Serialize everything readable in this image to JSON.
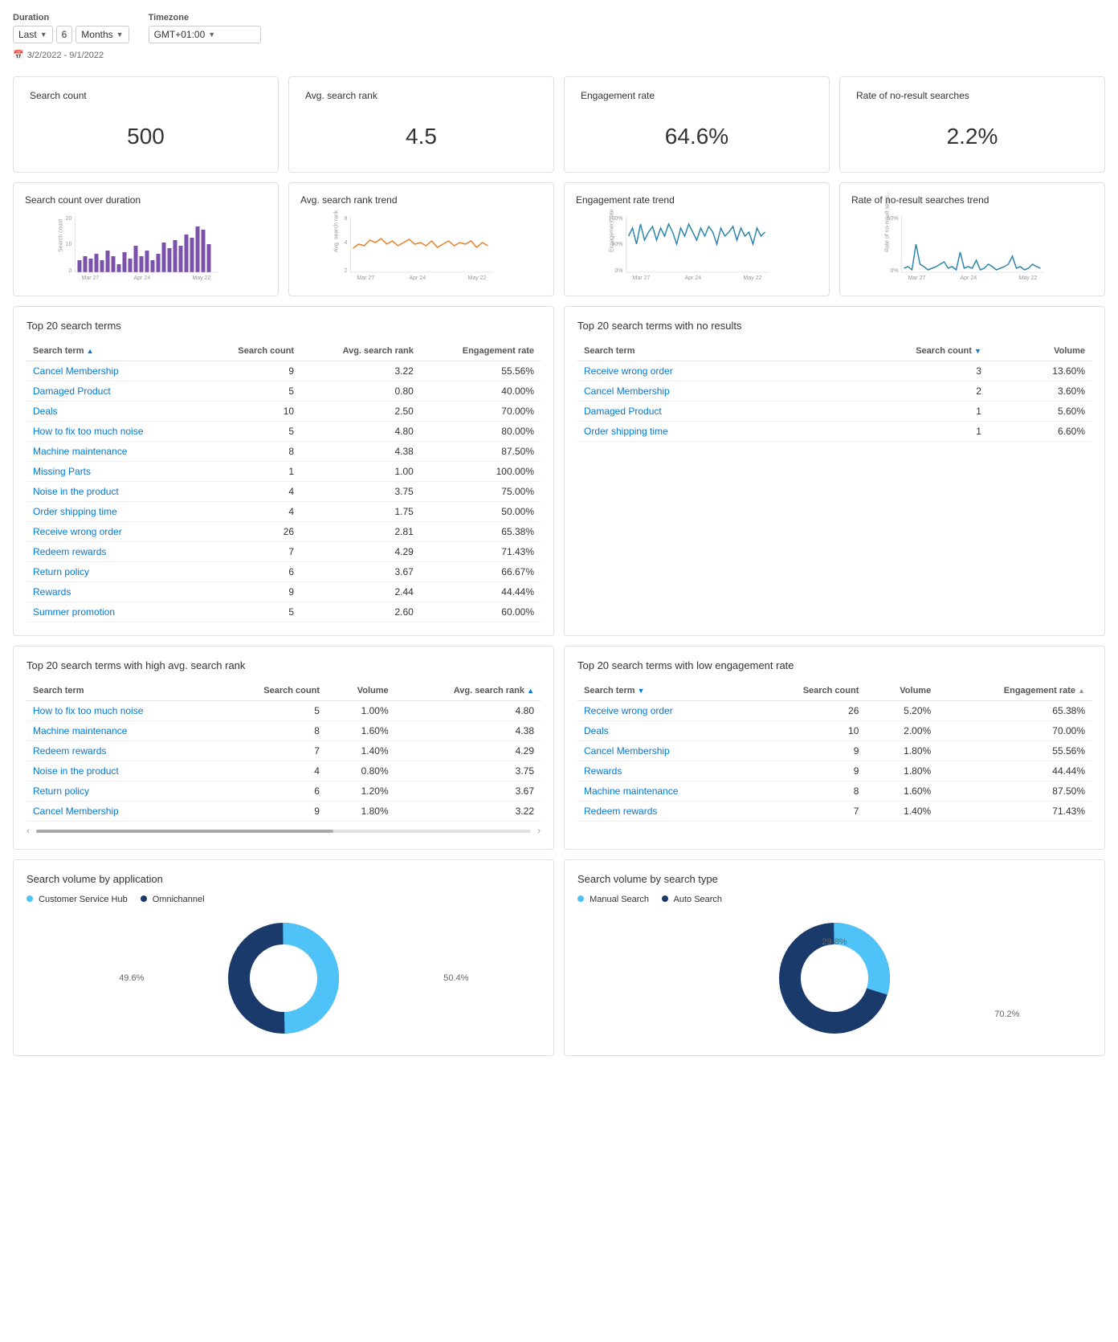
{
  "header": {
    "duration_label": "Duration",
    "timezone_label": "Timezone",
    "duration_prefix": "Last",
    "duration_value": "6",
    "duration_unit": "Months",
    "timezone_value": "GMT+01:00",
    "date_range": "3/2/2022 - 9/1/2022"
  },
  "stats": [
    {
      "title": "Search count",
      "value": "500"
    },
    {
      "title": "Avg. search rank",
      "value": "4.5"
    },
    {
      "title": "Engagement rate",
      "value": "64.6%"
    },
    {
      "title": "Rate of no-result searches",
      "value": "2.2%"
    }
  ],
  "chart_cards": [
    {
      "title": "Search count over duration",
      "type": "bar",
      "color": "#7B52AB",
      "ymax": 20,
      "ylabel": "Search count",
      "labels": [
        "Mar 27",
        "Apr 24",
        "May 22"
      ]
    },
    {
      "title": "Avg. search rank trend",
      "type": "line",
      "color": "#E8822B",
      "ymax": 8,
      "ylabel": "Avg. search rank",
      "labels": [
        "Mar 27",
        "Apr 24",
        "May 22"
      ]
    },
    {
      "title": "Engagement rate trend",
      "type": "line",
      "color": "#2E86AB",
      "ymax": 100,
      "ylabel": "Engagement rate",
      "labels": [
        "Mar 27",
        "Apr 24",
        "May 22"
      ]
    },
    {
      "title": "Rate of no-result searches trend",
      "type": "line",
      "color": "#2E86AB",
      "ymax": 50,
      "ylabel": "Rate of no-result searc...",
      "labels": [
        "Mar 27",
        "Apr 24",
        "May 22"
      ]
    }
  ],
  "top20_table": {
    "title": "Top 20 search terms",
    "columns": [
      "Search term",
      "Search count",
      "Avg. search rank",
      "Engagement rate"
    ],
    "rows": [
      [
        "Cancel Membership",
        "9",
        "3.22",
        "55.56%"
      ],
      [
        "Damaged Product",
        "5",
        "0.80",
        "40.00%"
      ],
      [
        "Deals",
        "10",
        "2.50",
        "70.00%"
      ],
      [
        "How to fix too much noise",
        "5",
        "4.80",
        "80.00%"
      ],
      [
        "Machine maintenance",
        "8",
        "4.38",
        "87.50%"
      ],
      [
        "Missing Parts",
        "1",
        "1.00",
        "100.00%"
      ],
      [
        "Noise in the product",
        "4",
        "3.75",
        "75.00%"
      ],
      [
        "Order shipping time",
        "4",
        "1.75",
        "50.00%"
      ],
      [
        "Receive wrong order",
        "26",
        "2.81",
        "65.38%"
      ],
      [
        "Redeem rewards",
        "7",
        "4.29",
        "71.43%"
      ],
      [
        "Return policy",
        "6",
        "3.67",
        "66.67%"
      ],
      [
        "Rewards",
        "9",
        "2.44",
        "44.44%"
      ],
      [
        "Summer promotion",
        "5",
        "2.60",
        "60.00%"
      ]
    ]
  },
  "no_results_table": {
    "title": "Top 20 search terms with no results",
    "columns": [
      "Search term",
      "Search count",
      "Volume"
    ],
    "rows": [
      [
        "Receive wrong order",
        "3",
        "13.60%"
      ],
      [
        "Cancel Membership",
        "2",
        "3.60%"
      ],
      [
        "Damaged Product",
        "1",
        "5.60%"
      ],
      [
        "Order shipping time",
        "1",
        "6.60%"
      ]
    ]
  },
  "high_rank_table": {
    "title": "Top 20 search terms with high avg. search rank",
    "columns": [
      "Search term",
      "Search count",
      "Volume",
      "Avg. search rank"
    ],
    "rows": [
      [
        "How to fix too much noise",
        "5",
        "1.00%",
        "4.80"
      ],
      [
        "Machine maintenance",
        "8",
        "1.60%",
        "4.38"
      ],
      [
        "Redeem rewards",
        "7",
        "1.40%",
        "4.29"
      ],
      [
        "Noise in the product",
        "4",
        "0.80%",
        "3.75"
      ],
      [
        "Return policy",
        "6",
        "1.20%",
        "3.67"
      ],
      [
        "Cancel Membership",
        "9",
        "1.80%",
        "3.22"
      ]
    ]
  },
  "low_engagement_table": {
    "title": "Top 20 search terms with low engagement rate",
    "columns": [
      "Search term",
      "Search count",
      "Volume",
      "Engagement rate"
    ],
    "rows": [
      [
        "Receive wrong order",
        "26",
        "5.20%",
        "65.38%"
      ],
      [
        "Deals",
        "10",
        "2.00%",
        "70.00%"
      ],
      [
        "Cancel Membership",
        "9",
        "1.80%",
        "55.56%"
      ],
      [
        "Rewards",
        "9",
        "1.80%",
        "44.44%"
      ],
      [
        "Machine maintenance",
        "8",
        "1.60%",
        "87.50%"
      ],
      [
        "Redeem rewards",
        "7",
        "1.40%",
        "71.43%"
      ]
    ]
  },
  "donut_application": {
    "title": "Search volume by application",
    "legend": [
      {
        "label": "Customer Service Hub",
        "color": "#4FC3F7"
      },
      {
        "label": "Omnichannel",
        "color": "#1A3A6B"
      }
    ],
    "segments": [
      {
        "label": "49.6%",
        "value": 49.6,
        "color": "#4FC3F7"
      },
      {
        "label": "50.4%",
        "value": 50.4,
        "color": "#1A3A6B"
      }
    ]
  },
  "donut_search_type": {
    "title": "Search volume by search type",
    "legend": [
      {
        "label": "Manual Search",
        "color": "#4FC3F7"
      },
      {
        "label": "Auto Search",
        "color": "#1A3A6B"
      }
    ],
    "segments": [
      {
        "label": "29.8%",
        "value": 29.8,
        "color": "#4FC3F7"
      },
      {
        "label": "70.2%",
        "value": 70.2,
        "color": "#1A3A6B"
      }
    ]
  }
}
